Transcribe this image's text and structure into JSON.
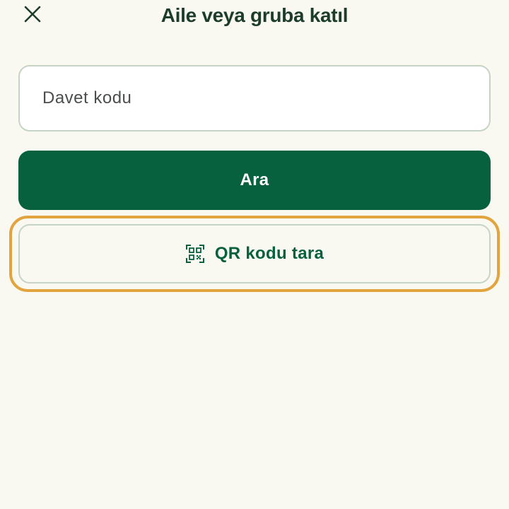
{
  "header": {
    "title": "Aile veya gruba katıl",
    "close_icon": "close-icon"
  },
  "invite_code": {
    "placeholder": "Davet kodu",
    "value": ""
  },
  "search_button": {
    "label": "Ara"
  },
  "qr_button": {
    "label": "QR kodu tara",
    "icon": "qr-code-scan-icon"
  },
  "colors": {
    "background": "#faf9f1",
    "primary": "#07613e",
    "title_text": "#1d3d2c",
    "border": "#c6d4c6",
    "focus_ring": "#e2a43e"
  }
}
